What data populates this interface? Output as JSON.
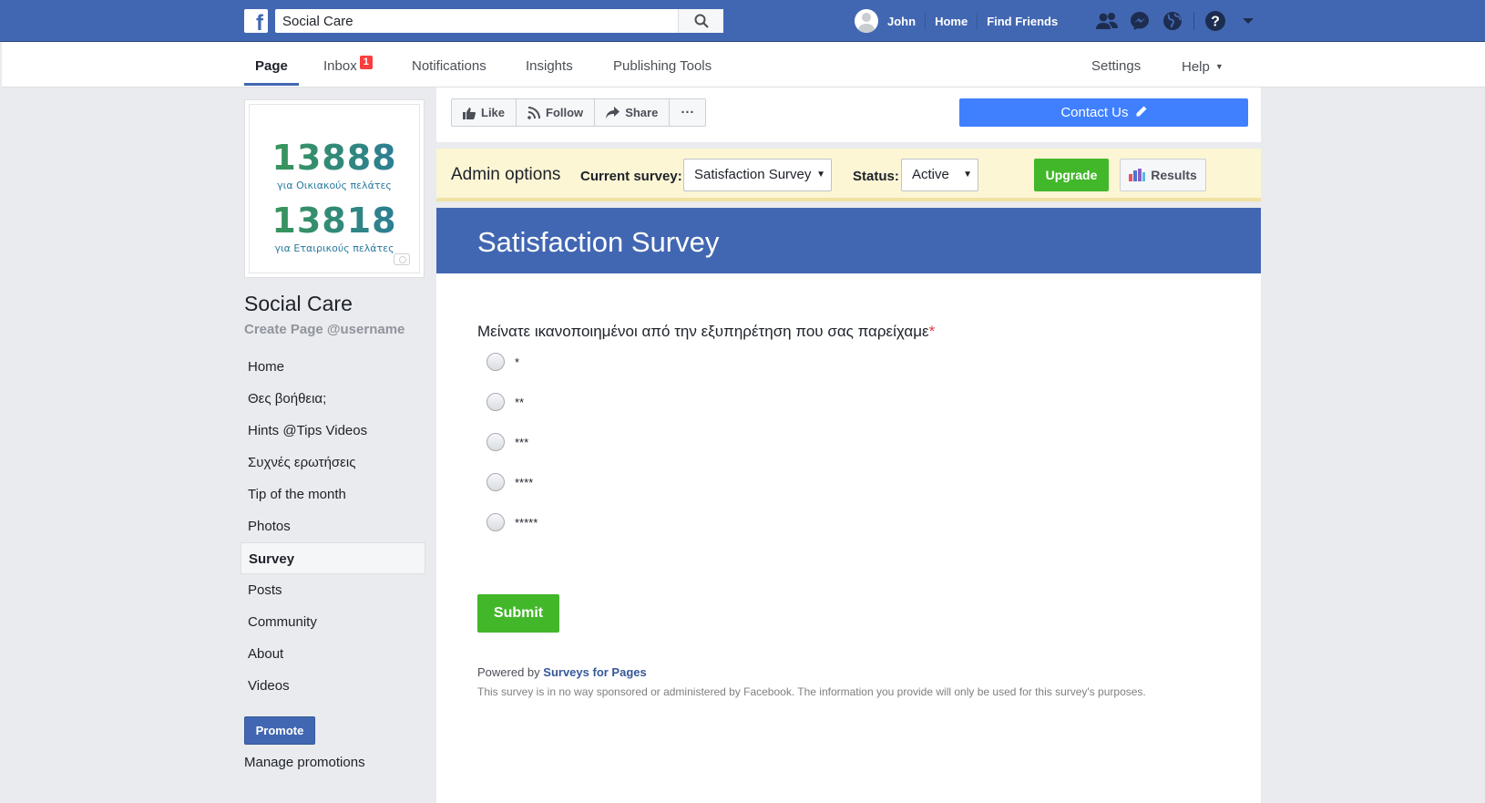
{
  "topbar": {
    "search_value": "Social Care",
    "user_name": "John",
    "nav_home": "Home",
    "nav_find_friends": "Find Friends",
    "icons": [
      "friend-requests-icon",
      "messenger-icon",
      "notifications-globe-icon",
      "help-icon",
      "account-menu-icon"
    ]
  },
  "tabs": {
    "page": "Page",
    "inbox": "Inbox",
    "inbox_count": "1",
    "notifications": "Notifications",
    "insights": "Insights",
    "publishing_tools": "Publishing Tools",
    "settings": "Settings",
    "help": "Help"
  },
  "profile": {
    "number_1": "13888",
    "caption_1": "για Οικιακούς πελάτες",
    "number_2": "13818",
    "caption_2": "για Εταιρικούς πελάτες"
  },
  "sidebar": {
    "page_name": "Social Care",
    "username_link": "Create Page @username",
    "items": [
      {
        "label": "Home"
      },
      {
        "label": "Θες βοήθεια;"
      },
      {
        "label": "Hints @Tips Videos"
      },
      {
        "label": "Συχνές ερωτήσεις"
      },
      {
        "label": "Tip of the month"
      },
      {
        "label": "Photos"
      },
      {
        "label": "Survey",
        "active": true
      },
      {
        "label": "Posts"
      },
      {
        "label": "Community"
      },
      {
        "label": "About"
      },
      {
        "label": "Videos"
      }
    ],
    "promote_label": "Promote",
    "manage_promotions": "Manage promotions"
  },
  "actions": {
    "like": "Like",
    "follow": "Follow",
    "share": "Share",
    "more": "···",
    "contact": "Contact Us"
  },
  "admin": {
    "title": "Admin options",
    "current_survey_label": "Current survey:",
    "current_survey_value": "Satisfaction Survey",
    "status_label": "Status:",
    "status_value": "Active",
    "upgrade": "Upgrade",
    "results": "Results"
  },
  "survey": {
    "title": "Satisfaction Survey",
    "question": "Μείνατε ικανοποιημένοι από την εξυπηρέτηση που σας παρείχαμε",
    "required_mark": "*",
    "options": [
      "*",
      "**",
      "***",
      "****",
      "*****"
    ],
    "submit": "Submit",
    "powered_prefix": "Powered by",
    "powered_link": "Surveys for Pages",
    "disclaimer": "This survey is in no way sponsored or administered by Facebook. The information you provide will only be used for this survey's purposes."
  },
  "colors": {
    "facebook_blue": "#4267b2",
    "contact_blue": "#4080ff",
    "green": "#42b72a",
    "admin_yellow": "#fcf6d5"
  }
}
